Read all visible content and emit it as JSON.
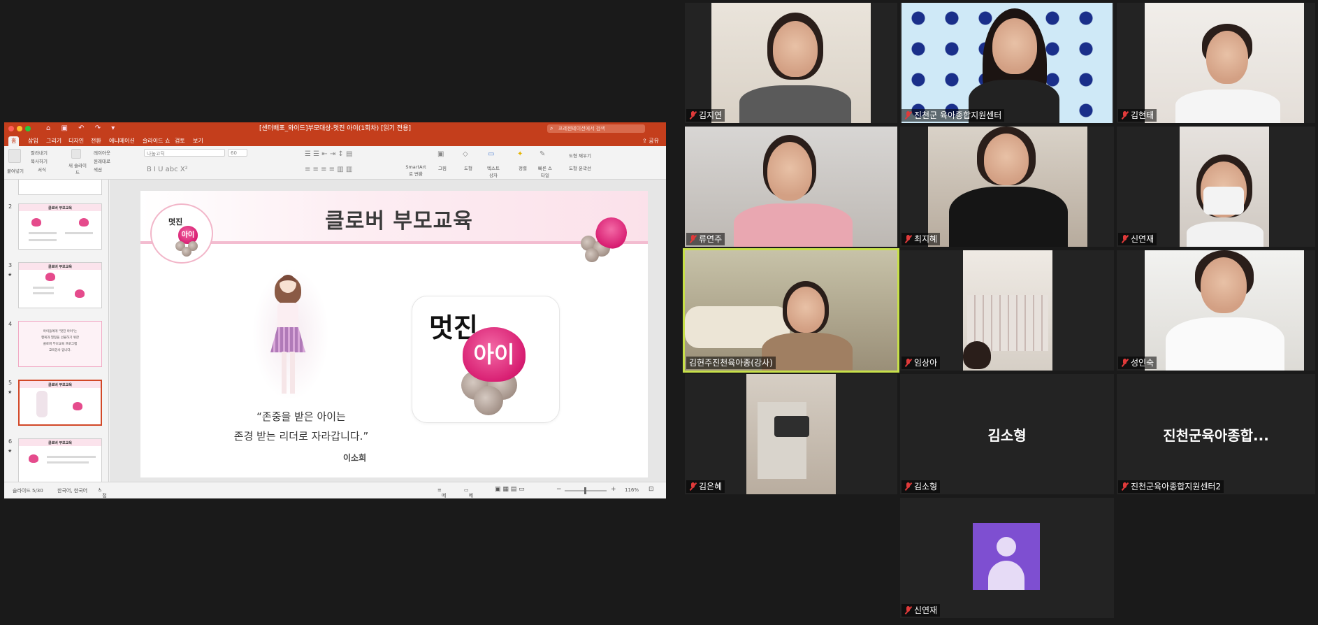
{
  "ppt": {
    "window_title": "[센터배포_와이드]부모대상-멋진 아이(1회차) [읽기 전용]",
    "search_placeholder": "프레젠테이션에서 검색",
    "tabs": [
      "홈",
      "삽입",
      "그리기",
      "디자인",
      "전환",
      "애니메이션",
      "슬라이드 쇼",
      "검토",
      "보기"
    ],
    "share_label": "공유",
    "ribbon": {
      "paste": "붙여넣기",
      "cut": "잘라내기",
      "copy": "복사하기",
      "format": "서식",
      "new_slide": "새 슬라이드",
      "layout": "레이아웃",
      "reset": "원래대로",
      "section": "섹션",
      "font_name": "나눔고딕",
      "font_size": "60",
      "convert_smartart": "SmartArt로 변환",
      "picture": "그림",
      "shape": "도형",
      "textbox": "텍스트 상자",
      "arrange": "정렬",
      "quick_styles": "빠른 스타일",
      "shape_fill": "도형 채우기",
      "shape_outline": "도형 윤곽선"
    },
    "thumbnails": [
      {
        "num": "2",
        "title": "클로버 부모교육",
        "star": ""
      },
      {
        "num": "3",
        "title": "클로버 부모교육",
        "star": "★"
      },
      {
        "num": "4",
        "title": "",
        "star": ""
      },
      {
        "num": "5",
        "title": "클로버 부모교육",
        "star": "★"
      },
      {
        "num": "6",
        "title": "클로버 부모교육",
        "star": "★"
      }
    ],
    "thumb4_text": [
      "아이들에게 \"멋진 아이\"는",
      "행복과 열정을 선물하기 위한",
      "클로버 부모교육 프로그램",
      "교육강사 입니다."
    ],
    "slide": {
      "title": "클로버 부모교육",
      "logo_text": "멋진",
      "logo_heart_text": "아이",
      "card_text": "멋진",
      "card_heart_text": "아이",
      "quote_line1": "“존중을 받은 아이는",
      "quote_line2": "존경 받는 리더로 자라갑니다.”",
      "author": "이소희"
    },
    "status": {
      "slide_pos": "슬라이드 5/30",
      "language": "한국어, 한국어",
      "accessibility": "접근성: 조사 필요",
      "notes": "메모",
      "comments": "메모",
      "zoom": "116%"
    }
  },
  "participants": [
    {
      "name": "김지연",
      "muted": true
    },
    {
      "name": "진천군 육아종합지원센터",
      "muted": true
    },
    {
      "name": "김현태",
      "muted": true
    },
    {
      "name": "류연주",
      "muted": true
    },
    {
      "name": "최지혜",
      "muted": true
    },
    {
      "name": "신연재",
      "muted": true
    },
    {
      "name": "김현주진천육아종(강사)",
      "muted": false,
      "active_speaker": true
    },
    {
      "name": "임상아",
      "muted": true
    },
    {
      "name": "성인숙",
      "muted": true
    },
    {
      "name": "김은혜",
      "muted": true
    },
    {
      "name": "김소형",
      "muted": true,
      "big_label": "김소형"
    },
    {
      "name": "진천군육아종합지원센터2",
      "muted": true,
      "big_label": "진천군육아종합..."
    },
    {
      "name": "신연재",
      "muted": true,
      "avatar": "person-icon"
    }
  ],
  "colors": {
    "ppt_accent": "#c43e1c",
    "active_speaker": "#c7e04a",
    "avatar_bg": "#7e4fd1",
    "mute_red": "#e03a3a"
  }
}
